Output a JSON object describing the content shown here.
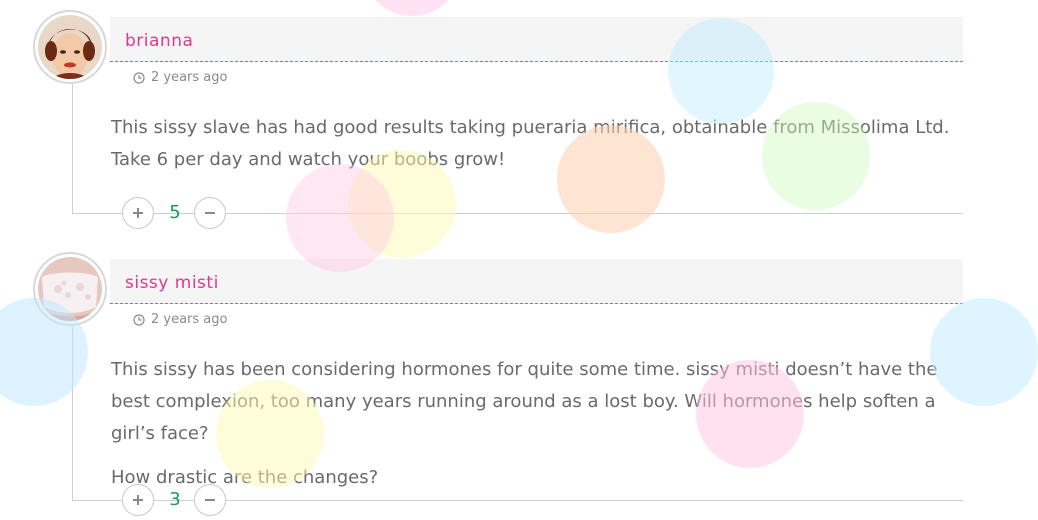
{
  "comments": [
    {
      "author": "brianna",
      "time": "2 years ago",
      "paragraphs": [
        "This sissy slave has had good results taking pueraria mirifica, obtainable from Missolima Ltd. Take 6 per day and watch your boobs grow!"
      ],
      "votes": "5",
      "upvote_icon": "plus-icon",
      "downvote_icon": "minus-icon"
    },
    {
      "author": "sissy misti",
      "time": "2 years ago",
      "paragraphs": [
        "This sissy has been considering hormones for quite some time. sissy misti doesn’t have the best complexion, too many years running around as a lost boy. Will hormones help soften a girl’s face?",
        "How drastic are the changes?"
      ],
      "votes": "3",
      "upvote_icon": "plus-icon",
      "downvote_icon": "minus-icon"
    }
  ],
  "colors": {
    "author": "#e0388f",
    "vote_count": "#1e9b58",
    "text": "#6a6a6a"
  }
}
